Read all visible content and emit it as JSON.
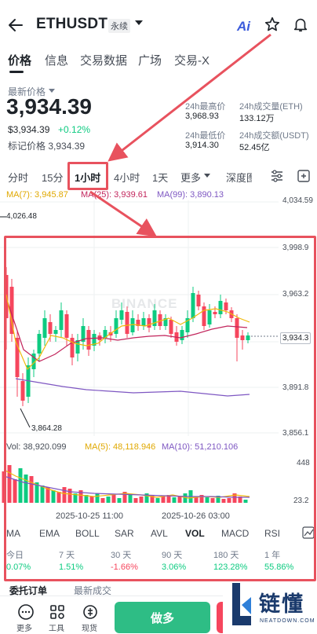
{
  "header": {
    "symbol": "ETHUSDT",
    "contract_type": "永续",
    "ai_label": "Ai"
  },
  "main_tabs": [
    "价格",
    "信息",
    "交易数据",
    "广场",
    "交易-X"
  ],
  "price": {
    "latest_label": "最新价格",
    "last": "3,934.39",
    "usd": "$3,934.39",
    "change": "+0.12%",
    "mark_label": "标记价格",
    "mark_value": "3,934.39"
  },
  "stats": {
    "high_label": "24h最高价",
    "high": "3,968.93",
    "low_label": "24h最低价",
    "low": "3,914.30",
    "vol_eth_label": "24h成交量(ETH)",
    "vol_eth": "133.12万",
    "vol_usdt_label": "24h成交额(USDT)",
    "vol_usdt": "52.45亿"
  },
  "intervals": [
    "分时",
    "15分",
    "1小时",
    "4小时",
    "1天",
    "更多",
    "深度图"
  ],
  "ma": {
    "ma7": "MA(7): 3,945.87",
    "ma25": "MA(25): 3,939.61",
    "ma99": "MA(99): 3,890.13"
  },
  "price_axis": [
    "4,034.59",
    "3,998.9",
    "3,963.2",
    "3,934.3",
    "3,891.8",
    "3,856.1"
  ],
  "extremes": {
    "high": "4,026.48",
    "low": "3,864.28"
  },
  "watermark": "BINANCE",
  "volume": {
    "vol": "Vol: 38,920.099",
    "ma5": "MA(5): 48,118.946",
    "ma10": "MA(10): 51,210.106",
    "axis_top": "448",
    "axis_bottom": "23.2"
  },
  "dates": [
    "2025-10-25 11:00",
    "2025-10-26 03:00"
  ],
  "indicators": [
    "MA",
    "EMA",
    "BOLL",
    "SAR",
    "AVL",
    "VOL",
    "MACD",
    "RSI"
  ],
  "performance": [
    {
      "label": "今日",
      "value": "0.07%"
    },
    {
      "label": "7 天",
      "value": "1.51%"
    },
    {
      "label": "30 天",
      "value": "-1.66%"
    },
    {
      "label": "90 天",
      "value": "3.06%"
    },
    {
      "label": "180 天",
      "value": "123.28%"
    },
    {
      "label": "1 年",
      "value": "55.86%"
    }
  ],
  "lower_tabs": [
    "委托订单",
    "最新成交"
  ],
  "bottom_nav": [
    "更多",
    "工具",
    "现货"
  ],
  "buy_label": "做多",
  "logo": {
    "text": "链懂",
    "sub": "NEATDOWN.COM"
  },
  "colors": {
    "up": "#0ecb81",
    "down": "#f6465d",
    "annotation": "#e8525e",
    "ma7": "#f0b90b",
    "ma25": "#c2255c",
    "ma99": "#7e57c2"
  }
}
